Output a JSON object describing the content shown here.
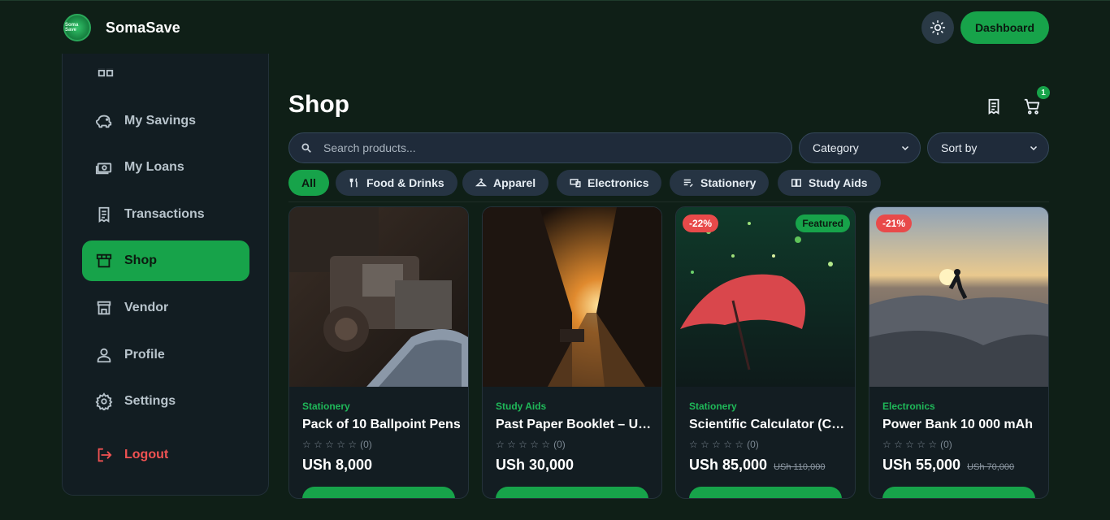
{
  "app": {
    "name": "SomaSave",
    "logo_text": "Soma Save",
    "dashboard_label": "Dashboard"
  },
  "colors": {
    "accent": "#17a34a",
    "danger": "#e84a4a",
    "background": "#0f1f17",
    "panel": "#121d22"
  },
  "sidebar": {
    "items": [
      {
        "label": "My Savings",
        "icon": "piggy-bank-icon"
      },
      {
        "label": "My Loans",
        "icon": "cash-icon"
      },
      {
        "label": "Transactions",
        "icon": "receipt-icon"
      },
      {
        "label": "Shop",
        "icon": "store-icon",
        "active": true
      },
      {
        "label": "Vendor",
        "icon": "vendor-icon"
      },
      {
        "label": "Profile",
        "icon": "user-icon"
      },
      {
        "label": "Settings",
        "icon": "gear-icon"
      },
      {
        "label": "Logout",
        "icon": "logout-icon"
      }
    ]
  },
  "shop": {
    "title": "Shop",
    "cart_count": "1",
    "search_placeholder": "Search products...",
    "category_label": "Category",
    "sort_label": "Sort by",
    "filters": [
      {
        "label": "All",
        "active": true
      },
      {
        "label": "Food & Drinks",
        "icon": "utensils-icon"
      },
      {
        "label": "Apparel",
        "icon": "hanger-icon"
      },
      {
        "label": "Electronics",
        "icon": "devices-icon"
      },
      {
        "label": "Stationery",
        "icon": "notes-icon"
      },
      {
        "label": "Study Aids",
        "icon": "book-icon"
      }
    ]
  },
  "products": [
    {
      "category": "Stationery",
      "name": "Pack of 10 Ballpoint Pens",
      "reviews": "(0)",
      "price": "USh 8,000",
      "old_price": "",
      "discount": "",
      "featured": "",
      "rating": 0
    },
    {
      "category": "Study Aids",
      "name": "Past Paper Booklet – UNEB",
      "reviews": "(0)",
      "price": "USh 30,000",
      "old_price": "",
      "discount": "",
      "featured": "",
      "rating": 0
    },
    {
      "category": "Stationery",
      "name": "Scientific Calculator (Casio)",
      "reviews": "(0)",
      "price": "USh 85,000",
      "old_price": "USh 110,000",
      "discount": "-22%",
      "featured": "Featured",
      "rating": 0
    },
    {
      "category": "Electronics",
      "name": "Power Bank 10 000 mAh",
      "reviews": "(0)",
      "price": "USh 55,000",
      "old_price": "USh 70,000",
      "discount": "-21%",
      "featured": "",
      "rating": 0
    }
  ]
}
